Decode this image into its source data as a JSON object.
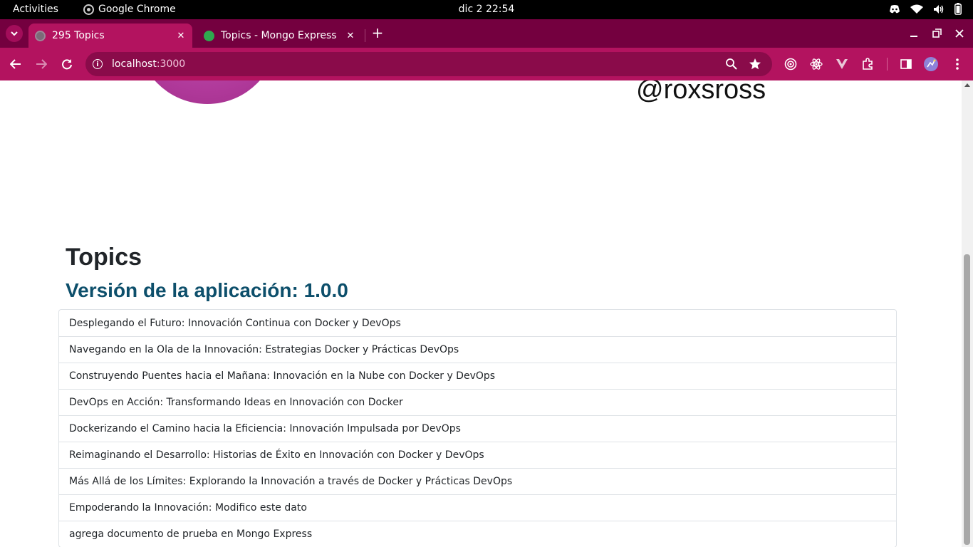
{
  "system_bar": {
    "activities": "Activities",
    "app_name": "Google Chrome",
    "clock": "dic 2  22:54"
  },
  "browser": {
    "tabs": [
      {
        "title": "295 Topics",
        "active": true
      },
      {
        "title": "Topics - Mongo Express",
        "active": false
      }
    ],
    "url_host": "localhost",
    "url_port": ":3000",
    "accent_color": "#b3135f",
    "tabstrip_color": "#74003f"
  },
  "page": {
    "handle": "@roxsross",
    "heading": "Topics",
    "version_heading": "Versión de la aplicación: 1.0.0",
    "topics": [
      "Desplegando el Futuro: Innovación Continua con Docker y DevOps",
      "Navegando en la Ola de la Innovación: Estrategias Docker y Prácticas DevOps",
      "Construyendo Puentes hacia el Mañana: Innovación en la Nube con Docker y DevOps",
      "DevOps en Acción: Transformando Ideas en Innovación con Docker",
      "Dockerizando el Camino hacia la Eficiencia: Innovación Impulsada por DevOps",
      "Reimaginando el Desarrollo: Historias de Éxito en Innovación con Docker y DevOps",
      "Más Allá de los Límites: Explorando la Innovación a través de Docker y Prácticas DevOps",
      "Empoderando la Innovación: Modifico este dato",
      "agrega documento de prueba en Mongo Express"
    ]
  }
}
